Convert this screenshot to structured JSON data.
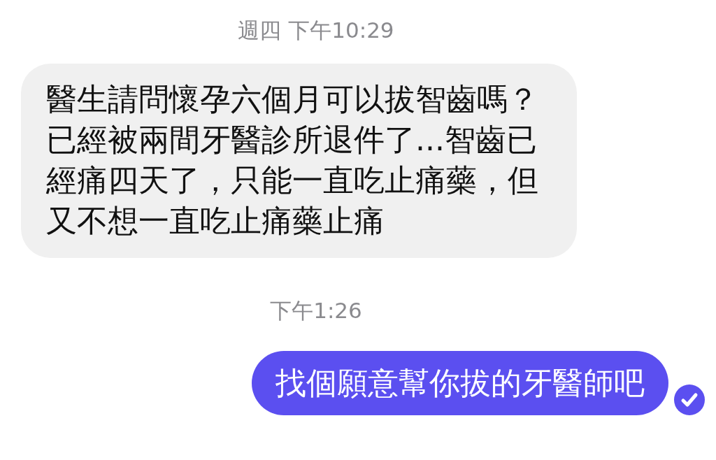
{
  "messages": [
    {
      "kind": "timestamp",
      "text": "週四 下午10:29"
    },
    {
      "kind": "incoming",
      "text": "醫生請問懷孕六個月可以拔智齒嗎？已經被兩間牙醫診所退件了...智齒已經痛四天了，只能一直吃止痛藥，但又不想一直吃止痛藥止痛"
    },
    {
      "kind": "timestamp",
      "text": "下午1:26"
    },
    {
      "kind": "outgoing",
      "text": "找個願意幫你拔的牙醫師吧",
      "seen": true
    }
  ]
}
